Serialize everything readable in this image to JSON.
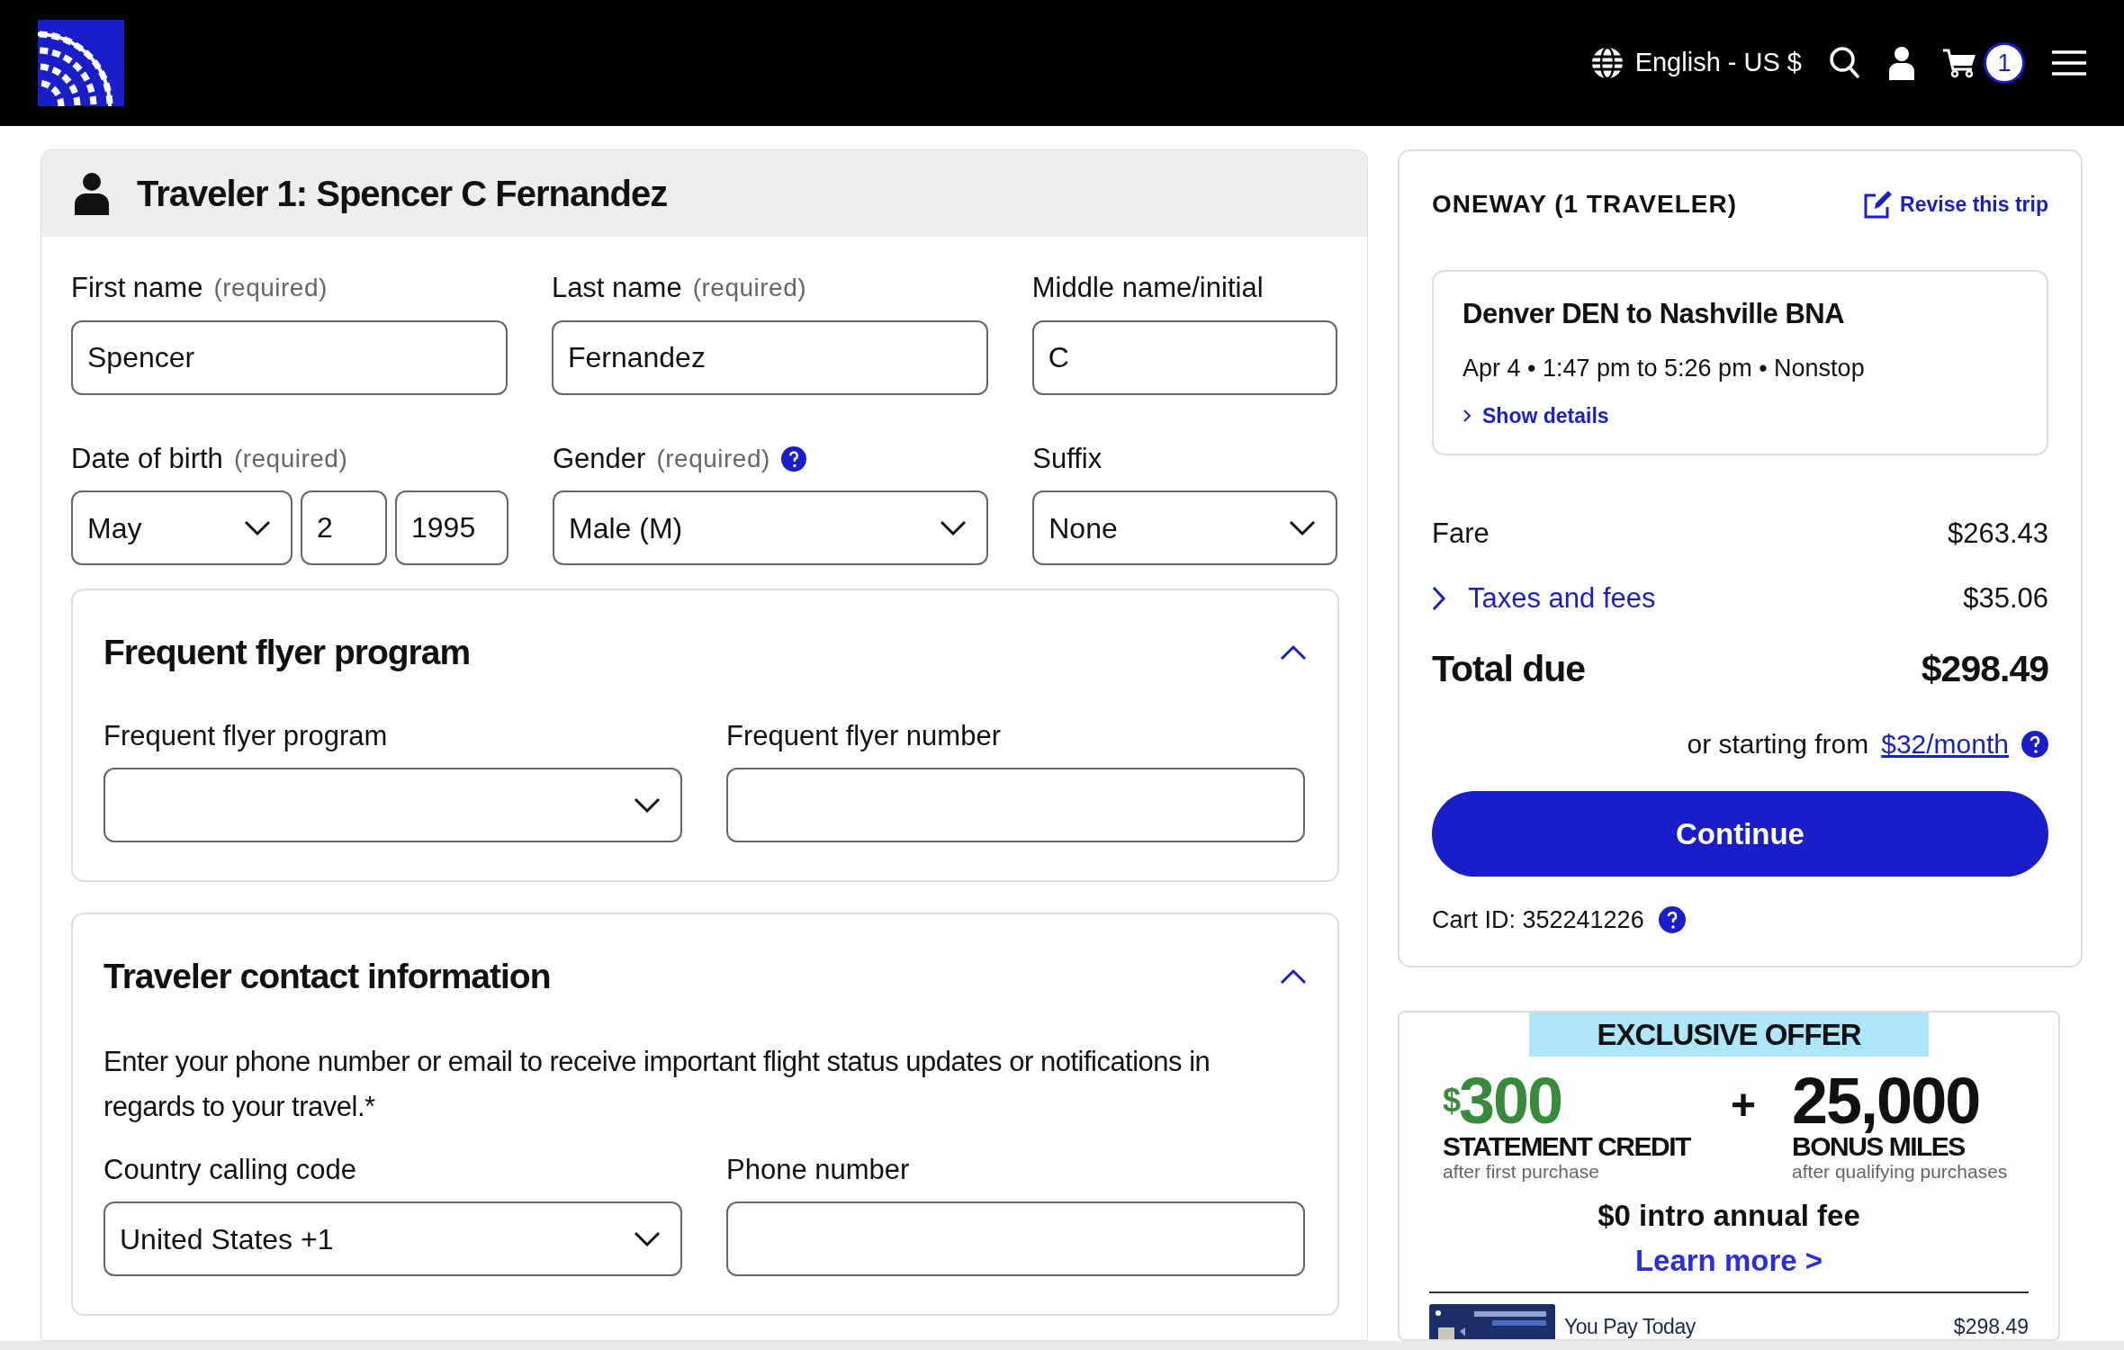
{
  "header": {
    "language": "English - US $",
    "cart_count": "1"
  },
  "traveler": {
    "title": "Traveler 1: Spencer C Fernandez",
    "rows": [
      [
        {
          "label": "First name",
          "hint": "(required)",
          "kind": "input",
          "value": "Spencer"
        },
        {
          "label": "Last name",
          "hint": "(required)",
          "kind": "input",
          "value": "Fernandez"
        },
        {
          "label": "Middle name/initial",
          "kind": "input",
          "value": "C"
        }
      ],
      [
        {
          "label": "Date of birth",
          "hint": "(required)",
          "kind": "date",
          "parts": [
            {
              "kind": "select",
              "value": "May"
            },
            {
              "kind": "input",
              "value": "2"
            },
            {
              "kind": "input",
              "value": "1995"
            }
          ]
        },
        {
          "label": "Gender",
          "hint": "(required)",
          "help": true,
          "kind": "select",
          "value": "Male (M)"
        },
        {
          "label": "Suffix",
          "kind": "select",
          "value": "None"
        }
      ]
    ]
  },
  "sections": [
    {
      "title": "Frequent flyer program",
      "expanded": true,
      "fields": [
        {
          "label": "Frequent flyer program",
          "kind": "select"
        },
        {
          "label": "Frequent flyer number",
          "kind": "input"
        }
      ]
    },
    {
      "title": "Traveler contact information",
      "expanded": true,
      "description": "Enter your phone number or email to receive important flight status updates or notifications in regards to your travel.*",
      "fields": [
        {
          "label": "Country calling code",
          "kind": "select",
          "value": "United States +1"
        },
        {
          "label": "Phone number",
          "kind": "input"
        }
      ]
    }
  ],
  "summary": {
    "heading": "ONEWAY (1 TRAVELER)",
    "revise_link": "Revise this trip",
    "flight": {
      "route": "Denver DEN to Nashville BNA",
      "times": "Apr 4 • 1:47 pm to 5:26 pm • Nonstop",
      "details_link": "Show details"
    },
    "fare": {
      "label": "Fare",
      "amount": "$263.43"
    },
    "taxes": {
      "label": "Taxes and fees",
      "amount": "$35.06"
    },
    "total": {
      "label": "Total due",
      "amount": "$298.49"
    },
    "financing": {
      "prefix": "or starting from",
      "link": "$32/month"
    },
    "continue": "Continue",
    "cart_id": "Cart ID: 352241226"
  },
  "ad": {
    "badge": "EXCLUSIVE OFFER",
    "credit": {
      "currency": "$",
      "amount": "300",
      "title": "STATEMENT CREDIT",
      "note": "after first purchase"
    },
    "plus": "+",
    "miles": {
      "amount": "25,000",
      "title": "BONUS MILES",
      "note": "after qualifying purchases"
    },
    "fee": "$0 intro annual fee",
    "link": "Learn more >",
    "pay_label": "You Pay Today",
    "pay_amount": "$298.49"
  }
}
